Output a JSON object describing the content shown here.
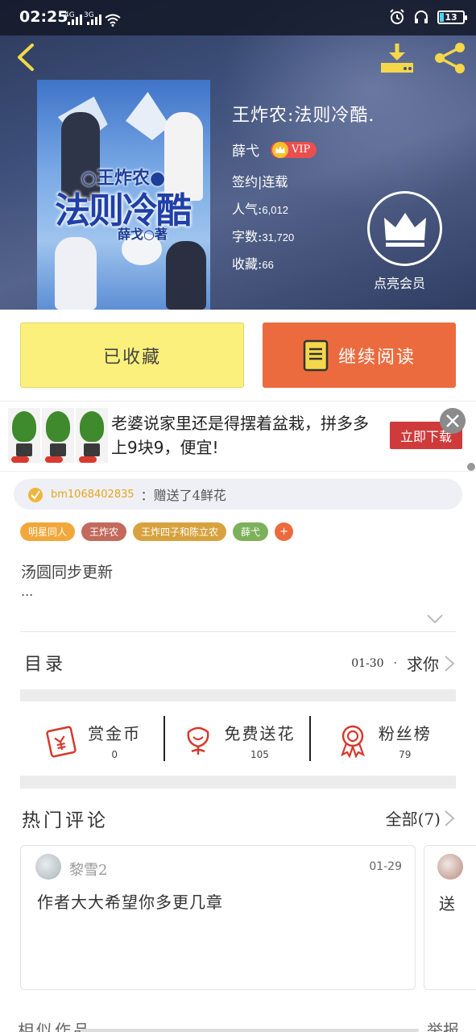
{
  "status_bar": {
    "time": "02:25",
    "signal1": "4G",
    "signal2": "3G",
    "battery": "13"
  },
  "book": {
    "title": "王炸农:法则冷酷.",
    "author": "薛弋",
    "vip": "VIP",
    "sign_status": "签约|连载",
    "popularity_label": "人气:",
    "popularity": "6,012",
    "words_label": "字数:",
    "words": "31,720",
    "favorites_label": "收藏:",
    "favorites": "66",
    "cover": {
      "subtitle": "○王炸农●",
      "title": "法则冷酷",
      "author_line": "薛戈○著"
    }
  },
  "vip_action": "点亮会员",
  "actions": {
    "collected": "已收藏",
    "continue_reading": "继续阅读"
  },
  "ad": {
    "text": "老婆说家里还是得摆着盆栽，拼多多上9块9，便宜!",
    "download": "立即下载"
  },
  "gift": {
    "user": "bm1068402835",
    "text": "：赠送了4鲜花"
  },
  "tags": [
    {
      "label": "明星同人",
      "color": "#f1a73c"
    },
    {
      "label": "王炸农",
      "color": "#c26a5c"
    },
    {
      "label": "王炸四子和陈立农",
      "color": "#d7a23e"
    },
    {
      "label": "薛弋",
      "color": "#7db05a"
    }
  ],
  "tag_plus": "+",
  "description": {
    "text": "汤圆同步更新",
    "ellipsis": "..."
  },
  "toc": {
    "label": "目录",
    "date": "01-30",
    "dot": "·",
    "latest": "求你"
  },
  "stats": [
    {
      "label": "赏金币",
      "value": "0",
      "icon": "red-packet-icon"
    },
    {
      "label": "免费送花",
      "value": "105",
      "icon": "flower-icon"
    },
    {
      "label": "粉丝榜",
      "value": "79",
      "icon": "medal-icon"
    }
  ],
  "comments_section": {
    "label": "热门评论",
    "all": "全部(7)"
  },
  "comments": [
    {
      "user": "黎雪2",
      "date": "01-29",
      "body": "作者大大希望你多更几章"
    },
    {
      "body": "送"
    }
  ],
  "similar": {
    "label": "相似作品",
    "right": "举报"
  },
  "colors": {
    "accent_orange": "#ec6b3e",
    "collect_yellow": "#fbf07b",
    "vip_red": "#e94f4f",
    "icon_yellow": "#f5d74a",
    "stat_red": "#d53a2c"
  }
}
